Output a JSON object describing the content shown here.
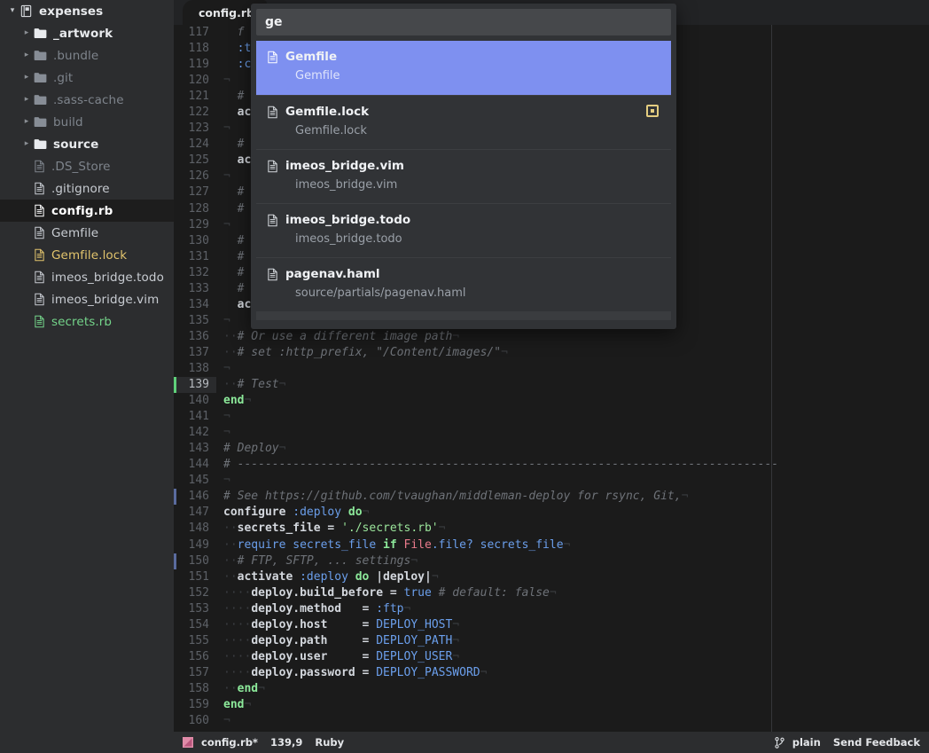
{
  "sidebar": {
    "project_name": "expenses",
    "project_icon": "repository-book-icon",
    "items": [
      {
        "label": "_artwork",
        "type": "folder",
        "icon": "folder-icon",
        "expandable": true,
        "style": "bright",
        "indent": 1
      },
      {
        "label": ".bundle",
        "type": "folder",
        "icon": "folder-icon",
        "expandable": true,
        "style": "dim",
        "indent": 1
      },
      {
        "label": ".git",
        "type": "folder",
        "icon": "folder-icon",
        "expandable": true,
        "style": "dim",
        "indent": 1
      },
      {
        "label": ".sass-cache",
        "type": "folder",
        "icon": "folder-icon",
        "expandable": true,
        "style": "dim",
        "indent": 1
      },
      {
        "label": "build",
        "type": "folder",
        "icon": "folder-icon",
        "expandable": true,
        "style": "dim",
        "indent": 1
      },
      {
        "label": "source",
        "type": "folder",
        "icon": "folder-icon",
        "expandable": true,
        "style": "bright",
        "indent": 1
      },
      {
        "label": ".DS_Store",
        "type": "file",
        "icon": "file-icon",
        "expandable": false,
        "style": "dim",
        "indent": 1
      },
      {
        "label": ".gitignore",
        "type": "file",
        "icon": "file-icon",
        "expandable": false,
        "style": "normal",
        "indent": 1
      },
      {
        "label": "config.rb",
        "type": "file",
        "icon": "file-icon",
        "expandable": false,
        "style": "white",
        "indent": 1,
        "selected": true
      },
      {
        "label": "Gemfile",
        "type": "file",
        "icon": "file-icon",
        "expandable": false,
        "style": "normal",
        "indent": 1
      },
      {
        "label": "Gemfile.lock",
        "type": "file",
        "icon": "file-icon",
        "expandable": false,
        "style": "yellow",
        "indent": 1
      },
      {
        "label": "imeos_bridge.todo",
        "type": "file",
        "icon": "file-icon",
        "expandable": false,
        "style": "normal",
        "indent": 1
      },
      {
        "label": "imeos_bridge.vim",
        "type": "file",
        "icon": "file-icon",
        "expandable": false,
        "style": "normal",
        "indent": 1
      },
      {
        "label": "secrets.rb",
        "type": "file",
        "icon": "file-icon",
        "expandable": false,
        "style": "green",
        "indent": 1
      }
    ]
  },
  "tabs": [
    {
      "label": "config.rb",
      "active": true,
      "modified": true
    }
  ],
  "finder": {
    "query": "ge",
    "placeholder": "",
    "results": [
      {
        "name": "Gemfile",
        "path": "Gemfile",
        "selected": true,
        "badge": false
      },
      {
        "name": "Gemfile.lock",
        "path": "Gemfile.lock",
        "selected": false,
        "badge": true
      },
      {
        "name": "imeos_bridge.vim",
        "path": "imeos_bridge.vim",
        "selected": false,
        "badge": false
      },
      {
        "name": "imeos_bridge.todo",
        "path": "imeos_bridge.todo",
        "selected": false,
        "badge": false
      },
      {
        "name": "pagenav.haml",
        "path": "source/partials/pagenav.haml",
        "selected": false,
        "badge": false
      }
    ]
  },
  "editor": {
    "first_line": 117,
    "lines": [
      {
        "n": 117,
        "tokens": [
          {
            "t": "  ",
            "c": "inv"
          },
          {
            "t": "f",
            "c": "c-com"
          }
        ]
      },
      {
        "n": 118,
        "tokens": [
          {
            "t": "  ",
            "c": "inv"
          },
          {
            "t": ":t",
            "c": "c-sym"
          }
        ]
      },
      {
        "n": 119,
        "tokens": [
          {
            "t": "  ",
            "c": "inv"
          },
          {
            "t": ":c",
            "c": "c-sym"
          }
        ]
      },
      {
        "n": 120,
        "tokens": [
          {
            "t": "¬",
            "c": "inv"
          }
        ]
      },
      {
        "n": 121,
        "tokens": [
          {
            "t": "  ",
            "c": "inv"
          },
          {
            "t": "#",
            "c": "c-com"
          }
        ]
      },
      {
        "n": 122,
        "tokens": [
          {
            "t": "  ",
            "c": "inv"
          },
          {
            "t": "ac",
            "c": "c-var"
          }
        ]
      },
      {
        "n": 123,
        "tokens": [
          {
            "t": "¬",
            "c": "inv"
          }
        ]
      },
      {
        "n": 124,
        "tokens": [
          {
            "t": "  ",
            "c": "inv"
          },
          {
            "t": "#",
            "c": "c-com"
          }
        ]
      },
      {
        "n": 125,
        "tokens": [
          {
            "t": "  ",
            "c": "inv"
          },
          {
            "t": "ac",
            "c": "c-var"
          }
        ]
      },
      {
        "n": 126,
        "tokens": [
          {
            "t": "¬",
            "c": "inv"
          }
        ]
      },
      {
        "n": 127,
        "tokens": [
          {
            "t": "  ",
            "c": "inv"
          },
          {
            "t": "#",
            "c": "c-com"
          }
        ]
      },
      {
        "n": 128,
        "tokens": [
          {
            "t": "  ",
            "c": "inv"
          },
          {
            "t": "#",
            "c": "c-com"
          }
        ]
      },
      {
        "n": 129,
        "tokens": [
          {
            "t": "¬",
            "c": "inv"
          }
        ]
      },
      {
        "n": 130,
        "tokens": [
          {
            "t": "  ",
            "c": "inv"
          },
          {
            "t": "#",
            "c": "c-com"
          }
        ]
      },
      {
        "n": 131,
        "tokens": [
          {
            "t": "  ",
            "c": "inv"
          },
          {
            "t": "#",
            "c": "c-com"
          }
        ]
      },
      {
        "n": 132,
        "tokens": [
          {
            "t": "  ",
            "c": "inv"
          },
          {
            "t": "#",
            "c": "c-com"
          }
        ]
      },
      {
        "n": 133,
        "tokens": [
          {
            "t": "  ",
            "c": "inv"
          },
          {
            "t": "#",
            "c": "c-com"
          }
        ]
      },
      {
        "n": 134,
        "tokens": [
          {
            "t": "  ",
            "c": "inv"
          },
          {
            "t": "ac",
            "c": "c-var"
          }
        ]
      },
      {
        "n": 135,
        "tokens": [
          {
            "t": "¬",
            "c": "inv"
          }
        ]
      },
      {
        "n": 136,
        "tokens": [
          {
            "t": "··",
            "c": "inv"
          },
          {
            "t": "# Or use a different image path",
            "c": "c-com"
          },
          {
            "t": "¬",
            "c": "inv"
          }
        ]
      },
      {
        "n": 137,
        "tokens": [
          {
            "t": "··",
            "c": "inv"
          },
          {
            "t": "# set :http_prefix, \"/Content/images/\"",
            "c": "c-com"
          },
          {
            "t": "¬",
            "c": "inv"
          }
        ]
      },
      {
        "n": 138,
        "tokens": [
          {
            "t": "¬",
            "c": "inv"
          }
        ]
      },
      {
        "n": 139,
        "current": true,
        "gutter": "added",
        "tokens": [
          {
            "t": "··",
            "c": "inv"
          },
          {
            "t": "# Test",
            "c": "c-com"
          },
          {
            "t": "¬",
            "c": "inv"
          }
        ]
      },
      {
        "n": 140,
        "tokens": [
          {
            "t": "end",
            "c": "c-kw"
          },
          {
            "t": "¬",
            "c": "inv"
          }
        ]
      },
      {
        "n": 141,
        "tokens": [
          {
            "t": "¬",
            "c": "inv"
          }
        ]
      },
      {
        "n": 142,
        "tokens": [
          {
            "t": "¬",
            "c": "inv"
          }
        ]
      },
      {
        "n": 143,
        "tokens": [
          {
            "t": "# Deploy",
            "c": "c-com"
          },
          {
            "t": "¬",
            "c": "inv"
          }
        ]
      },
      {
        "n": 144,
        "tokens": [
          {
            "t": "# ------------------------------------------------------------------------------",
            "c": "c-com"
          }
        ]
      },
      {
        "n": 145,
        "tokens": [
          {
            "t": "¬",
            "c": "inv"
          }
        ]
      },
      {
        "n": 146,
        "gutter": "modified",
        "tokens": [
          {
            "t": "# See https://github.com/tvaughan/middleman-deploy for rsync, Git,",
            "c": "c-com"
          },
          {
            "t": "¬",
            "c": "inv"
          }
        ]
      },
      {
        "n": 147,
        "tokens": [
          {
            "t": "configure ",
            "c": "c-var"
          },
          {
            "t": ":deploy",
            "c": "c-sym"
          },
          {
            "t": " ",
            "c": "c-plain"
          },
          {
            "t": "do",
            "c": "c-kw"
          },
          {
            "t": "¬",
            "c": "inv"
          }
        ]
      },
      {
        "n": 148,
        "tokens": [
          {
            "t": "··",
            "c": "inv"
          },
          {
            "t": "secrets_file = ",
            "c": "c-var"
          },
          {
            "t": "'./secrets.rb'",
            "c": "c-str"
          },
          {
            "t": "¬",
            "c": "inv"
          }
        ]
      },
      {
        "n": 149,
        "tokens": [
          {
            "t": "··",
            "c": "inv"
          },
          {
            "t": "require secrets_file ",
            "c": "c-sym"
          },
          {
            "t": "if",
            "c": "c-kw"
          },
          {
            "t": " ",
            "c": "c-plain"
          },
          {
            "t": "File",
            "c": "c-red"
          },
          {
            "t": ".file? secrets_file",
            "c": "c-sym"
          },
          {
            "t": "¬",
            "c": "inv"
          }
        ]
      },
      {
        "n": 150,
        "gutter": "modified",
        "tokens": [
          {
            "t": "··",
            "c": "inv"
          },
          {
            "t": "# FTP, SFTP, ... settings",
            "c": "c-com"
          },
          {
            "t": "¬",
            "c": "inv"
          }
        ]
      },
      {
        "n": 151,
        "tokens": [
          {
            "t": "··",
            "c": "inv"
          },
          {
            "t": "activate ",
            "c": "c-var"
          },
          {
            "t": ":deploy",
            "c": "c-sym"
          },
          {
            "t": " ",
            "c": "c-plain"
          },
          {
            "t": "do",
            "c": "c-kw"
          },
          {
            "t": " |deploy|",
            "c": "c-var"
          },
          {
            "t": "¬",
            "c": "inv"
          }
        ]
      },
      {
        "n": 152,
        "tokens": [
          {
            "t": "····",
            "c": "inv"
          },
          {
            "t": "deploy.build_before = ",
            "c": "c-var"
          },
          {
            "t": "true",
            "c": "c-sym"
          },
          {
            "t": " ",
            "c": "c-plain"
          },
          {
            "t": "# default: false",
            "c": "c-com"
          },
          {
            "t": "¬",
            "c": "inv"
          }
        ]
      },
      {
        "n": 153,
        "tokens": [
          {
            "t": "····",
            "c": "inv"
          },
          {
            "t": "deploy.method   = ",
            "c": "c-var"
          },
          {
            "t": ":ftp",
            "c": "c-sym"
          },
          {
            "t": "¬",
            "c": "inv"
          }
        ]
      },
      {
        "n": 154,
        "tokens": [
          {
            "t": "····",
            "c": "inv"
          },
          {
            "t": "deploy.host     = ",
            "c": "c-var"
          },
          {
            "t": "DEPLOY_HOST",
            "c": "c-const"
          },
          {
            "t": "¬",
            "c": "inv"
          }
        ]
      },
      {
        "n": 155,
        "tokens": [
          {
            "t": "····",
            "c": "inv"
          },
          {
            "t": "deploy.path     = ",
            "c": "c-var"
          },
          {
            "t": "DEPLOY_PATH",
            "c": "c-const"
          },
          {
            "t": "¬",
            "c": "inv"
          }
        ]
      },
      {
        "n": 156,
        "tokens": [
          {
            "t": "····",
            "c": "inv"
          },
          {
            "t": "deploy.user     = ",
            "c": "c-var"
          },
          {
            "t": "DEPLOY_USER",
            "c": "c-const"
          },
          {
            "t": "¬",
            "c": "inv"
          }
        ]
      },
      {
        "n": 157,
        "tokens": [
          {
            "t": "····",
            "c": "inv"
          },
          {
            "t": "deploy.password = ",
            "c": "c-var"
          },
          {
            "t": "DEPLOY_PASSWORD",
            "c": "c-const"
          },
          {
            "t": "¬",
            "c": "inv"
          }
        ]
      },
      {
        "n": 158,
        "tokens": [
          {
            "t": "··",
            "c": "inv"
          },
          {
            "t": "end",
            "c": "c-kw"
          },
          {
            "t": "¬",
            "c": "inv"
          }
        ]
      },
      {
        "n": 159,
        "tokens": [
          {
            "t": "end",
            "c": "c-kw"
          },
          {
            "t": "¬",
            "c": "inv"
          }
        ]
      },
      {
        "n": 160,
        "tokens": [
          {
            "t": "¬",
            "c": "inv"
          }
        ]
      }
    ]
  },
  "statusbar": {
    "left": {
      "mode_icon": "vim-mode-icon",
      "filename": "config.rb*",
      "cursor": "139,9",
      "grammar": "Ruby"
    },
    "right": {
      "branch_icon": "git-branch-icon",
      "branch": "plain",
      "feedback": "Send Feedback"
    }
  },
  "colors": {
    "sidebar_bg": "#2c2d2f",
    "editor_bg": "#1b1b1b",
    "statusbar_bg": "#2c2d2f",
    "finder_bg": "#313336",
    "finder_selected": "#7e90f0",
    "gutter_added": "#5fd07a",
    "gutter_modified": "#5a6b9e",
    "badge_border": "#e4cd80",
    "file_green": "#74d48a",
    "file_yellow": "#e2c46d"
  }
}
